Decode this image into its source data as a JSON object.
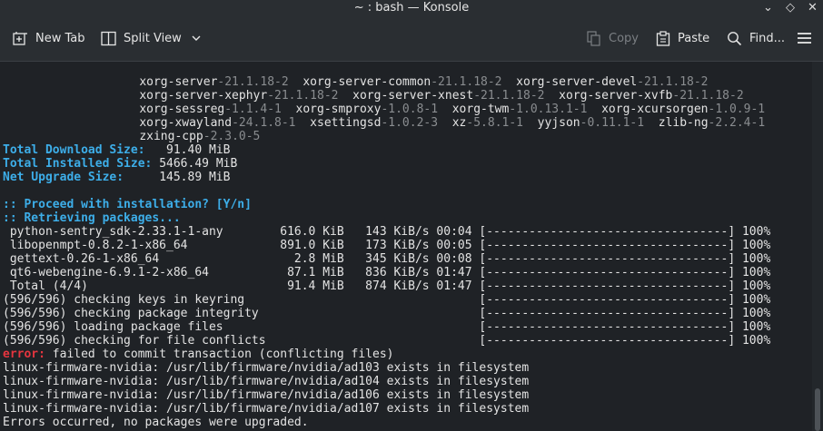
{
  "window": {
    "title": "~ : bash — Konsole"
  },
  "window_controls": {
    "minimize": "⌄",
    "maximize": "◇",
    "close": "✕"
  },
  "toolbar": {
    "new_tab": "New Tab",
    "split_view": "Split View",
    "copy": "Copy",
    "paste": "Paste",
    "find": "Find..."
  },
  "terminal": {
    "package_rows": [
      [
        [
          "xorg-server",
          "-21.1.18-2"
        ],
        [
          "xorg-server-common",
          "-21.1.18-2"
        ],
        [
          "xorg-server-devel",
          "-21.1.18-2"
        ]
      ],
      [
        [
          "xorg-server-xephyr",
          "-21.1.18-2"
        ],
        [
          "xorg-server-xnest",
          "-21.1.18-2"
        ],
        [
          "xorg-server-xvfb",
          "-21.1.18-2"
        ]
      ],
      [
        [
          "xorg-sessreg",
          "-1.1.4-1"
        ],
        [
          "xorg-smproxy",
          "-1.0.8-1"
        ],
        [
          "xorg-twm",
          "-1.0.13.1-1"
        ],
        [
          "xorg-xcursorgen",
          "-1.0.9-1"
        ]
      ],
      [
        [
          "xorg-xwayland",
          "-24.1.8-1"
        ],
        [
          "xsettingsd",
          "-1.0.2-3"
        ],
        [
          "xz",
          "-5.8.1-1"
        ],
        [
          "yyjson",
          "-0.11.1-1"
        ],
        [
          "zlib-ng",
          "-2.2.4-1"
        ]
      ],
      [
        [
          "zxing-cpp",
          "-2.3.0-5"
        ]
      ]
    ],
    "sizes": [
      {
        "label": "Total Download Size:",
        "value": "   91.40 MiB"
      },
      {
        "label": "Total Installed Size:",
        "value": " 5466.49 MiB"
      },
      {
        "label": "Net Upgrade Size:",
        "value": "     145.89 MiB"
      }
    ],
    "proceed": ":: Proceed with installation? [Y/n]",
    "retrieving": ":: Retrieving packages...",
    "downloads": [
      " python-sentry_sdk-2.33.1-1-any        616.0 KiB   143 KiB/s 00:04 [----------------------------------] 100%",
      " libopenmpt-0.8.2-1-x86_64             891.0 KiB   173 KiB/s 00:05 [----------------------------------] 100%",
      " gettext-0.26-1-x86_64                   2.8 MiB   345 KiB/s 00:08 [----------------------------------] 100%",
      " qt6-webengine-6.9.1-2-x86_64           87.1 MiB   836 KiB/s 01:47 [----------------------------------] 100%",
      " Total (4/4)                            91.4 MiB   874 KiB/s 01:47 [----------------------------------] 100%"
    ],
    "checks": [
      "(596/596) checking keys in keyring                                 [----------------------------------] 100%",
      "(596/596) checking package integrity                               [----------------------------------] 100%",
      "(596/596) loading package files                                    [----------------------------------] 100%",
      "(596/596) checking for file conflicts                              [----------------------------------] 100%"
    ],
    "error_prefix": "error:",
    "error_message": " failed to commit transaction (conflicting files)",
    "conflicts": [
      "linux-firmware-nvidia: /usr/lib/firmware/nvidia/ad103 exists in filesystem",
      "linux-firmware-nvidia: /usr/lib/firmware/nvidia/ad104 exists in filesystem",
      "linux-firmware-nvidia: /usr/lib/firmware/nvidia/ad106 exists in filesystem",
      "linux-firmware-nvidia: /usr/lib/firmware/nvidia/ad107 exists in filesystem"
    ],
    "final": "Errors occurred, no packages were upgraded."
  },
  "colors": {
    "accent": "#3daee9",
    "error": "#e5353f",
    "background": "#1f2226"
  }
}
